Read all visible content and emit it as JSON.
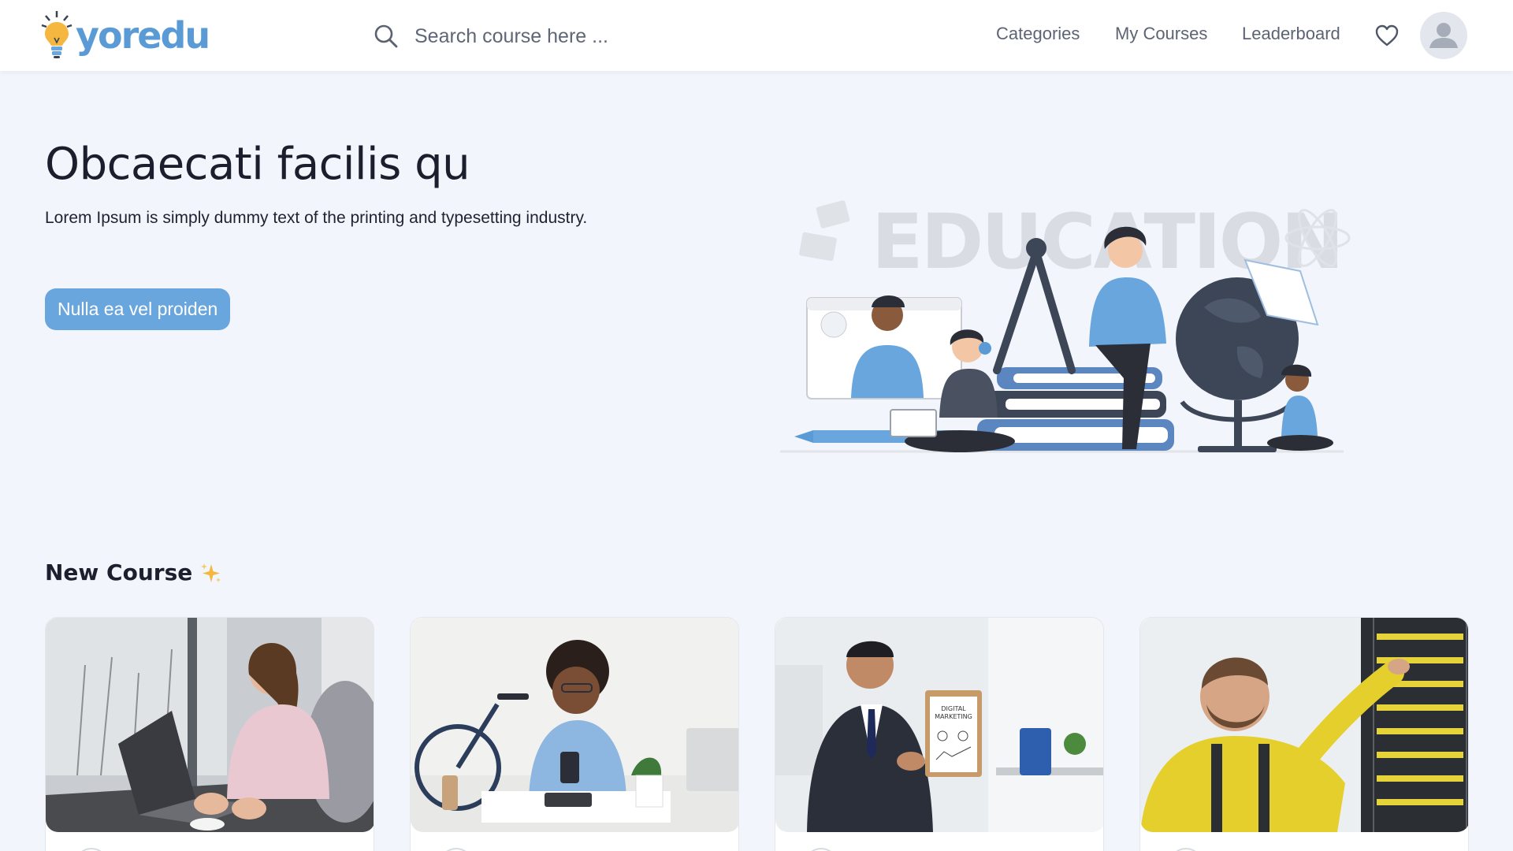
{
  "header": {
    "logo_text": "yoredu",
    "search_placeholder": "Search course here ...",
    "nav": [
      "Categories",
      "My Courses",
      "Leaderboard"
    ]
  },
  "hero": {
    "title": "Obcaecati facilis qu",
    "subtitle": "Lorem Ipsum is simply dummy text of the printing and typesetting industry.",
    "cta_label": "Nulla ea vel proiden",
    "illustration_text": "EDUCATION"
  },
  "courses": {
    "section_title": "New Course",
    "sparkle_icon": "sparkle-icon",
    "cards": [
      {
        "image": "woman-typing-laptop-photo"
      },
      {
        "image": "woman-reading-phone-photo"
      },
      {
        "image": "man-digital-marketing-clipboard-photo"
      },
      {
        "image": "technician-server-rack-photo"
      }
    ]
  },
  "colors": {
    "accent": "#6aa6de",
    "logo_blue": "#5b9bd5",
    "logo_bulb": "#f5b740",
    "background": "#f2f5fb"
  }
}
